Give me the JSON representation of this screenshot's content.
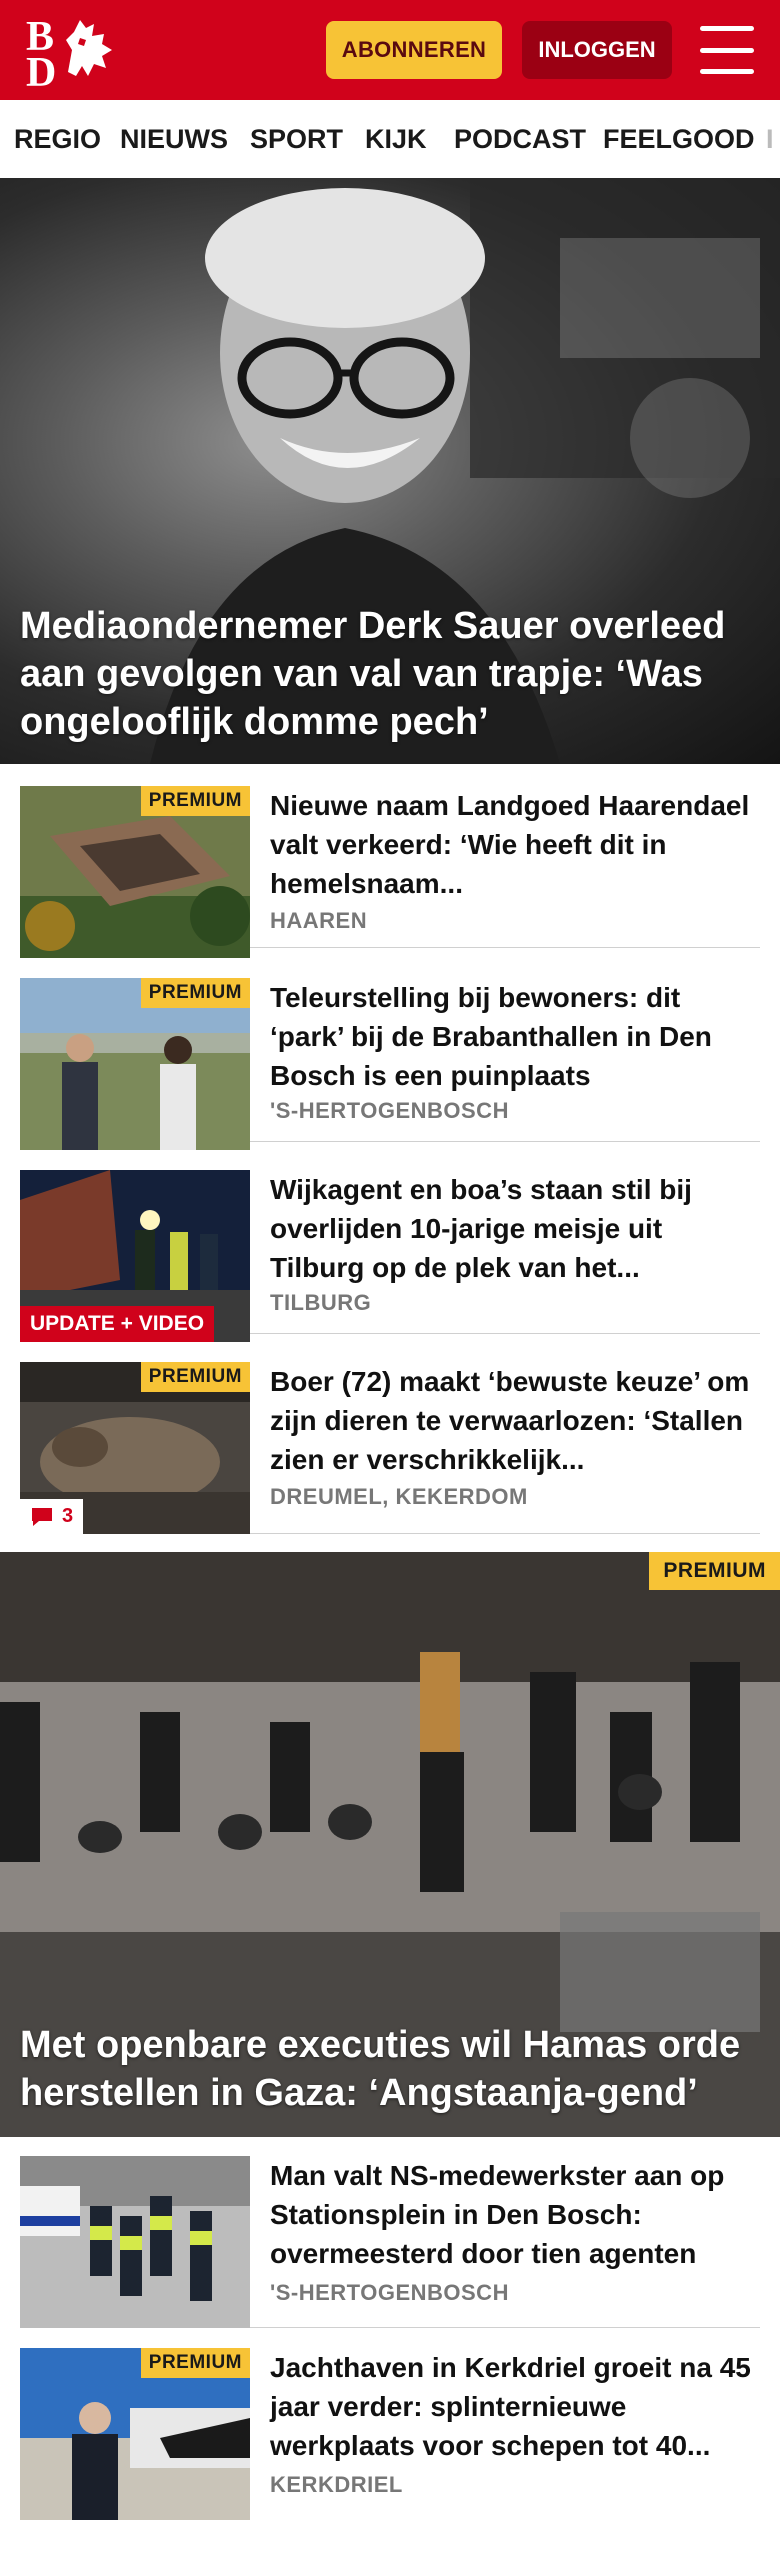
{
  "header": {
    "logo_alt": "BD",
    "subscribe_label": "ABONNEREN",
    "login_label": "INLOGGEN",
    "colors": {
      "brand_red": "#d0021b",
      "subscribe_yellow": "#f7c336",
      "login_dark_red": "#9b0013"
    }
  },
  "nav": {
    "items": [
      "REGIO",
      "NIEUWS",
      "SPORT",
      "KIJK",
      "PODCAST",
      "FEELGOOD"
    ]
  },
  "hero": {
    "title": "Mediaondernemer Derk Sauer overleed aan gevolgen van val van trapje: ‘Was ongelooflijk domme pech’"
  },
  "articles": [
    {
      "title": "Nieuwe naam Landgoed Haarendael valt verkeerd: ‘Wie heeft dit in hemelsnaam...",
      "location": "HAAREN",
      "badge": "PREMIUM"
    },
    {
      "title": "Teleurstelling bij bewoners: dit ‘park’ bij de Brabanthallen in Den Bosch is een puinplaats",
      "location": "'S-HERTOGENBOSCH",
      "badge": "PREMIUM"
    },
    {
      "title": "Wijkagent en boa’s staan stil bij overlijden 10-jarige meisje uit Tilburg op de plek van het...",
      "location": "TILBURG",
      "badge": "UPDATE + VIDEO"
    },
    {
      "title": "Boer (72) maakt ‘bewuste keuze’ om zijn dieren te verwaarlozen: ‘Stallen zien er verschrikkelijk...",
      "location": "DREUMEL, KEKERDOM",
      "badge": "PREMIUM",
      "comments": "3"
    }
  ],
  "hero2": {
    "badge": "PREMIUM",
    "title": "Met openbare executies wil Hamas orde herstellen in Gaza: ‘Angstaanja-gend’"
  },
  "articles2": [
    {
      "title": "Man valt NS-medewerkster aan op Stationsplein in Den Bosch: overmeesterd door tien agenten",
      "location": "'S-HERTOGENBOSCH"
    },
    {
      "title": "Jachthaven in Kerkdriel groeit na 45 jaar verder: splinternieuwe werkplaats voor schepen tot 40...",
      "location": "KERKDRIEL",
      "badge": "PREMIUM"
    }
  ]
}
